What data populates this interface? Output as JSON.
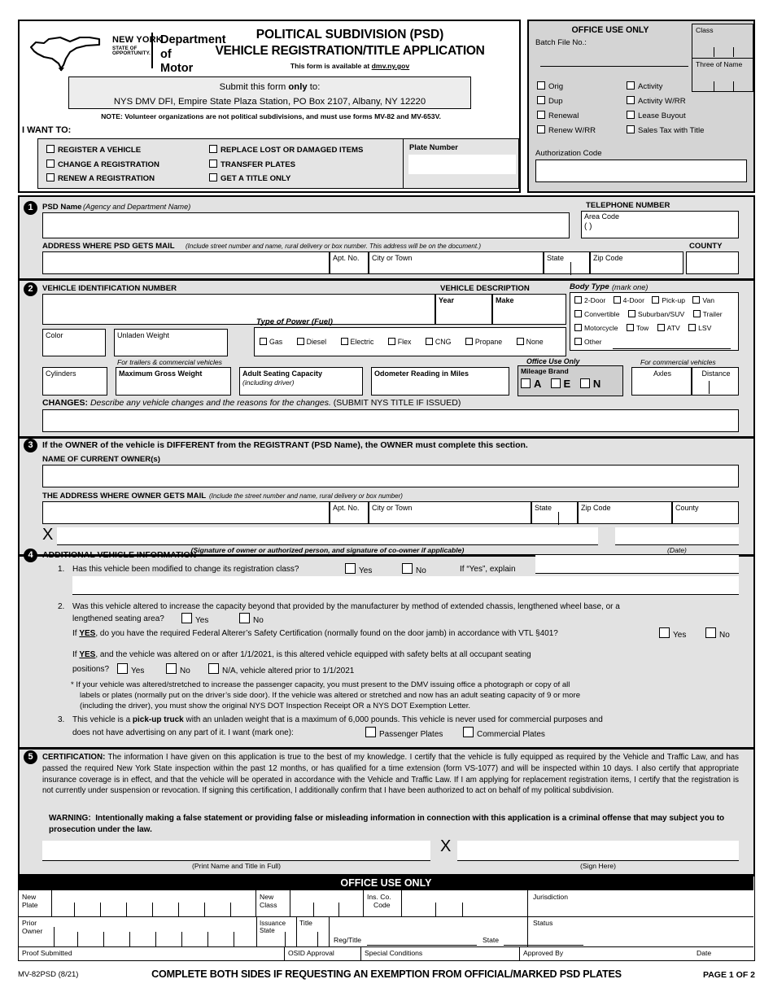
{
  "header": {
    "agency_line1": "NEW YORK",
    "agency_line2": "STATE OF",
    "agency_line3": "OPPORTUNITY.",
    "department_line1": "Department of",
    "department_line2": "Motor Vehicles",
    "title_line1": "POLITICAL SUBDIVISION (PSD)",
    "title_line2": "VEHICLE REGISTRATION/TITLE APPLICATION",
    "availability_prefix": "This form is available at ",
    "availability_url": "dmv.ny.gov",
    "submit_line1_a": "Submit this form ",
    "submit_line1_b": "only",
    "submit_line1_c": " to:",
    "submit_line2": "NYS DMV DFI, Empire State Plaza Station, PO Box 2107, Albany, NY 12220",
    "note": "NOTE: Volunteer organizations are not political subdivisions, and must use forms MV-82 and MV-653V.",
    "i_want_to": "I WANT TO:",
    "want_options_left": [
      "REGISTER A VEHICLE",
      "CHANGE A REGISTRATION",
      "RENEW A REGISTRATION"
    ],
    "want_options_right": [
      "REPLACE LOST OR DAMAGED ITEMS",
      "TRANSFER PLATES",
      "GET A TITLE ONLY"
    ],
    "plate_number_label": "Plate Number",
    "plate_number_value": ""
  },
  "office_top": {
    "title": "OFFICE USE ONLY",
    "batch_file_label": "Batch File No.:",
    "batch_file_value": "",
    "checks_left": [
      "Orig",
      "Dup",
      "Renewal",
      "Renew W/RR"
    ],
    "checks_right": [
      "Activity",
      "Activity W/RR",
      "Lease Buyout",
      "Sales Tax with Title"
    ],
    "authorization_code_label": "Authorization Code",
    "authorization_code_value": "",
    "class_label": "Class",
    "three_of_name_label": "Three of Name"
  },
  "section1": {
    "number": "1",
    "psd_name_label": "PSD Name",
    "psd_name_hint": "(Agency and Department Name)",
    "psd_name_value": "",
    "telephone_label": "TELEPHONE NUMBER",
    "area_code_label": "Area Code",
    "area_code_paren": "(          )",
    "telephone_value": "",
    "address_label": "ADDRESS WHERE PSD GETS MAIL",
    "address_hint": "(Include street number and name, rural delivery or box number. This address will be on the document.)",
    "address_value": "",
    "apt_no_label": "Apt. No.",
    "apt_no_value": "",
    "city_label": "City or Town",
    "city_value": "",
    "state_label": "State",
    "state_value": "",
    "zip_label": "Zip Code",
    "zip_value": "",
    "county_label": "COUNTY",
    "county_value": ""
  },
  "section2": {
    "number": "2",
    "vin_label": "VEHICLE IDENTIFICATION NUMBER",
    "vin_value": "",
    "vehicle_description_label": "VEHICLE DESCRIPTION",
    "year_label": "Year",
    "year_value": "",
    "make_label": "Make",
    "make_value": "",
    "body_type_label": "Body Type",
    "body_type_hint": "(mark one)",
    "body_types_row1": [
      "2-Door",
      "4-Door",
      "Pick-up",
      "Van"
    ],
    "body_types_row2": [
      "Convertible",
      "Suburban/SUV",
      "Trailer"
    ],
    "body_types_row3": [
      "Motorcycle",
      "Tow",
      "ATV",
      "LSV"
    ],
    "body_type_other": "Other",
    "body_type_other_value": "",
    "color_label": "Color",
    "color_value": "",
    "unladen_weight_label": "Unladen Weight",
    "unladen_weight_value": "",
    "fuel_label": "Type of Power (Fuel)",
    "fuel_options": [
      "Gas",
      "Diesel",
      "Electric",
      "Flex",
      "CNG",
      "Propane",
      "None"
    ],
    "cylinders_label": "Cylinders",
    "cylinders_value": "",
    "trailers_note": "For trailers & commercial vehicles",
    "max_gross_weight_label": "Maximum Gross Weight",
    "max_gross_weight_value": "",
    "adult_seating_label": "Adult Seating Capacity",
    "adult_seating_hint": "(including driver)",
    "adult_seating_value": "",
    "odometer_label": "Odometer Reading in Miles",
    "odometer_value": "",
    "office_use_only_label": "Office Use Only",
    "mileage_brand_label": "Mileage Brand",
    "mileage_brands": [
      "A",
      "E",
      "N"
    ],
    "commercial_note": "For commercial vehicles",
    "axles_label": "Axles",
    "axles_value": "",
    "distance_label": "Distance",
    "distance_value": "",
    "changes_label": "CHANGES:",
    "changes_text": "Describe any vehicle changes and the reasons for the changes.",
    "changes_paren": "(SUBMIT NYS TITLE IF ISSUED)",
    "changes_value": ""
  },
  "section3": {
    "number": "3",
    "heading": "If the OWNER of the vehicle is DIFFERENT from the REGISTRANT (PSD Name), the OWNER must complete this section.",
    "owner_name_label": "NAME OF CURRENT OWNER(s)",
    "owner_name_value": "",
    "owner_address_label": "THE ADDRESS WHERE OWNER GETS MAIL",
    "owner_address_hint": "(Include the street number and name, rural delivery or box number)",
    "owner_address_value": "",
    "apt_no_label": "Apt. No.",
    "apt_no_value": "",
    "city_label": "City or Town",
    "city_value": "",
    "state_label": "State",
    "state_value": "",
    "zip_label": "Zip Code",
    "zip_value": "",
    "county_label": "County",
    "county_value": "",
    "signature_x": "X",
    "signature_value": "",
    "signature_caption": "(Signature of owner or authorized person, and signature of co-owner if applicable)",
    "date_value": "",
    "date_caption": "(Date)"
  },
  "section4": {
    "number": "4",
    "heading": "ADDITIONAL VEHICLE INFORMATION",
    "q1_num": "1.",
    "q1_text": "Has this vehicle been modified to change its registration class?",
    "q1_yes": "Yes",
    "q1_no": "No",
    "q1_explain_label": "If “Yes”, explain",
    "q1_explain_value": "",
    "q2_num": "2.",
    "q2_text_line1": "Was this vehicle altered to increase the capacity beyond that provided by the manufacturer by method of extended chassis, lengthened wheel base, or a",
    "q2_text_line2": "lengthened seating area?",
    "q2_yes": "Yes",
    "q2_no": "No",
    "q2b_prefix": "If ",
    "q2b_yes_word": "YES",
    "q2b_text": ", do you have the required Federal Alterer’s Safety Certification (normally found on the door jamb) in accordance with VTL §401?",
    "q2b_yes": "Yes",
    "q2b_no": "No",
    "q2c_prefix": "If ",
    "q2c_yes_word": "YES",
    "q2c_text_line1": ", and the vehicle was altered on or after 1/1/2021, is this altered vehicle equipped with safety belts at all occupant seating",
    "q2c_text_line2": "positions?",
    "q2c_yes": "Yes",
    "q2c_no": "No",
    "q2c_na": "N/A, vehicle altered prior to 1/1/2021",
    "footnote_line1": "* If your vehicle was altered/stretched to increase the passenger capacity, you must present to the DMV issuing office a photograph or copy of all",
    "footnote_line2": "labels or plates (normally put on the driver’s side door). If the vehicle was altered or stretched and now has an adult seating capacity of 9 or more",
    "footnote_line3": "(including the driver), you must show the original NYS DOT Inspection Receipt OR a NYS DOT Exemption Letter.",
    "q3_num": "3.",
    "q3_text_a": "This vehicle is a ",
    "q3_bold": "pick-up truck",
    "q3_text_b": " with an unladen weight that is a maximum of 6,000 pounds. This vehicle is never used for commercial purposes and",
    "q3_text_line2": "does not have advertising on any part of it.  I want (mark one):",
    "q3_opt1": "Passenger Plates",
    "q3_opt2": "Commercial Plates"
  },
  "section5": {
    "number": "5",
    "cert_label": "CERTIFICATION:",
    "cert_text": " The information I have given on this application is true to the best of my knowledge. I certify that the vehicle is fully equipped as required by the Vehicle and Traffic Law, and has passed the required New York State inspection within the past 12 months, or has qualified for a time extension (form VS-1077) and will be inspected within 10 days. I also certify that appropriate insurance coverage is in effect, and that the vehicle will be operated in accordance with the Vehicle and Traffic Law. If I am applying for replacement registration items, I certify that the registration is not currently under suspension or revocation. If signing this certification, I additionally confirm that I have been authorized to act on behalf of my political subdivision.",
    "warning_label": "WARNING:",
    "warning_text": "Intentionally making a false statement or providing false or misleading information in connection with this application is a criminal offense that may subject you to prosecution under the law.",
    "print_name_value": "",
    "print_name_caption": "(Print Name and Title in Full)",
    "sign_x": "X",
    "sign_value": "",
    "sign_caption": "(Sign Here)"
  },
  "office_bottom": {
    "title": "OFFICE USE ONLY",
    "new_plate_label1": "New",
    "new_plate_label2": "Plate",
    "new_plate_value": "",
    "new_class_label1": "New",
    "new_class_label2": "Class",
    "new_class_value": "",
    "ins_co_label1": "Ins.  Co.",
    "ins_co_label2": "Code",
    "ins_co_value": "",
    "jurisdiction_label": "Jurisdiction",
    "jurisdiction_value": "",
    "prior_owner_label1": "Prior",
    "prior_owner_label2": "Owner",
    "prior_owner_value": "",
    "issuance_state_label1": "Issuance",
    "issuance_state_label2": "State",
    "issuance_state_value": "",
    "title_label": "Title",
    "title_value": "",
    "reg_title_label": "Reg/Title",
    "reg_title_value": "",
    "state_label": "State",
    "state_value": "",
    "status_label": "Status",
    "status_value": "",
    "proof_submitted_label": "Proof Submitted",
    "proof_submitted_value": "",
    "osid_approval_label": "OSID Approval",
    "osid_approval_value": "",
    "special_conditions_label": "Special Conditions",
    "special_conditions_value": "",
    "approved_by_label": "Approved By",
    "approved_by_value": "",
    "date_label": "Date",
    "date_value": ""
  },
  "footer": {
    "form_id": "MV-82PSD (8/21)",
    "main_text": "COMPLETE BOTH SIDES IF REQUESTING AN EXEMPTION FROM OFFICIAL/MARKED PSD PLATES",
    "page_text": "PAGE 1 OF 2"
  }
}
